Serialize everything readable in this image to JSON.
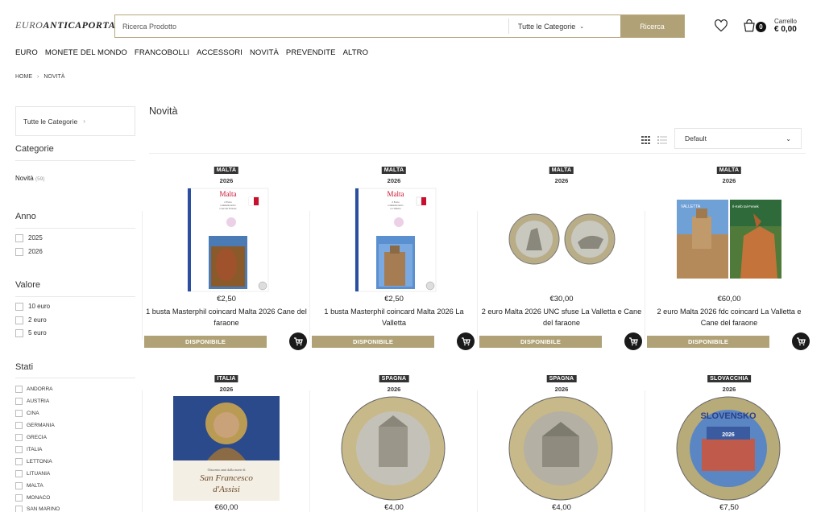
{
  "header": {
    "logo": {
      "part1": "EURO",
      "part2": "ANTICAPORTA"
    },
    "search": {
      "placeholder": "Ricerca Prodotto",
      "category": "Tutte le Categorie",
      "button": "Ricerca"
    },
    "cart": {
      "count": "0",
      "label": "Carrello",
      "total": "€ 0,00"
    }
  },
  "nav": [
    "EURO",
    "MONETE DEL MONDO",
    "FRANCOBOLLI",
    "ACCESSORI",
    "NOVITÀ",
    "PREVENDITE",
    "ALTRO"
  ],
  "breadcrumb": {
    "home": "HOME",
    "sep": "›",
    "current": "NOVITÀ"
  },
  "sidebar": {
    "category_box": "Tutte le Categorie",
    "categories_title": "Categorie",
    "novita": {
      "label": "Novità",
      "count": "(59)"
    },
    "anno": {
      "title": "Anno",
      "items": [
        "2025",
        "2026"
      ]
    },
    "valore": {
      "title": "Valore",
      "items": [
        "10 euro",
        "2 euro",
        "5 euro"
      ]
    },
    "stati": {
      "title": "Stati",
      "items": [
        "ANDORRA",
        "AUSTRIA",
        "CINA",
        "GERMANIA",
        "GRECIA",
        "ITALIA",
        "LETTONIA",
        "LITUANIA",
        "MALTA",
        "MONACO",
        "SAN MARINO"
      ]
    }
  },
  "main": {
    "title": "Novità",
    "sort": "Default",
    "products": [
      {
        "country": "MALTA",
        "year": "2026",
        "price": "€2,50",
        "name": "1 busta Masterphil coincard Malta 2026 Cane del faraone",
        "status": "DISPONIBILE",
        "image_text": [
          "Malta",
          "2 Euro",
          "commemorativo",
          "Cane del Faraone"
        ]
      },
      {
        "country": "MALTA",
        "year": "2026",
        "price": "€2,50",
        "name": "1 busta Masterphil coincard Malta 2026 La Valletta",
        "status": "DISPONIBILE",
        "image_text": [
          "Malta",
          "2 Euro",
          "commemorativo",
          "La Valletta"
        ]
      },
      {
        "country": "MALTA",
        "year": "2026",
        "price": "€30,00",
        "name": "2 euro Malta 2026 UNC sfuse La Valletta e Cane del faraone",
        "status": "DISPONIBILE"
      },
      {
        "country": "MALTA",
        "year": "2026",
        "price": "€60,00",
        "name": "2 euro Malta 2026 fdc coincard La Valletta e Cane del faraone",
        "status": "DISPONIBILE",
        "image_text": [
          "VALLETTA",
          "Il-Kelb tal-Fenek"
        ]
      },
      {
        "country": "ITALIA",
        "year": "2026",
        "price": "€60,00",
        "image_text": [
          "Ottocento anni dalla morte di",
          "San Francesco",
          "d'Assisi"
        ]
      },
      {
        "country": "SPAGNA",
        "year": "2026",
        "price": "€4,00"
      },
      {
        "country": "SPAGNA",
        "year": "2026",
        "price": "€4,00"
      },
      {
        "country": "SLOVACCHIA",
        "year": "2026",
        "price": "€7,50",
        "image_text": [
          "SLOVENSKO",
          "2026"
        ]
      }
    ]
  },
  "colors": {
    "accent": "#b0a276",
    "badge": "#333333",
    "cart_button": "#1a1a1a"
  },
  "icons": [
    "heart-icon",
    "cart-icon",
    "grid-view-icon",
    "list-view-icon",
    "add-to-cart-icon",
    "chevron-down-icon",
    "chevron-right-icon"
  ]
}
